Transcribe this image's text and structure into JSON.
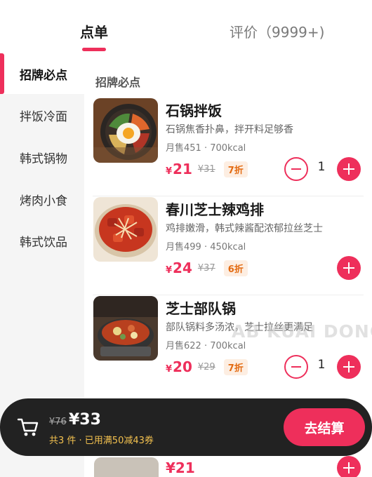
{
  "tabs": {
    "order": "点单",
    "reviews": "评价（9999+)"
  },
  "sidebar": {
    "items": [
      {
        "label": "招牌必点",
        "active": true
      },
      {
        "label": "拌饭冷面"
      },
      {
        "label": "韩式锅物"
      },
      {
        "label": "烤肉小食"
      },
      {
        "label": "韩式饮品"
      }
    ]
  },
  "section": {
    "title": "招牌必点"
  },
  "dishes": [
    {
      "name": "石锅拌饭",
      "desc": "石锅焦香扑鼻，拌开料足够香",
      "meta": "月售451 · 700kcal",
      "price": "21",
      "currency": "¥",
      "original": "¥31",
      "discount": "7折",
      "qty": "1"
    },
    {
      "name": "春川芝士辣鸡排",
      "desc": "鸡排嫩滑，韩式辣酱配浓郁拉丝芝士",
      "meta": "月售499 · 450kcal",
      "price": "24",
      "currency": "¥",
      "original": "¥37",
      "discount": "6折",
      "qty": ""
    },
    {
      "name": "芝士部队锅",
      "desc": "部队锅料多汤浓，芝士拉丝更满足",
      "meta": "月售622 · 700kcal",
      "price": "20",
      "currency": "¥",
      "original": "¥29",
      "discount": "7折",
      "qty": "1"
    },
    {
      "price": "¥21"
    }
  ],
  "watermark": "AB KUAI DONG",
  "cart": {
    "original": "¥76",
    "total": "¥33",
    "info": "共3 件 · 已用满50减43券",
    "checkout": "去结算"
  },
  "colors": {
    "accent": "#ee2f5b",
    "discount_text": "#e36b12",
    "cart_bg": "#222222",
    "cart_info": "#f3c14f"
  },
  "icons": [
    "cart-icon",
    "minus-icon",
    "plus-icon"
  ]
}
